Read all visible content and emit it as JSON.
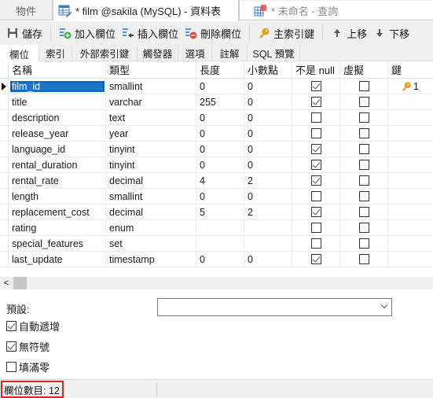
{
  "doc_tabs": {
    "objects": "物件",
    "active": "* film @sakila (MySQL) - 資料表",
    "query": "* 未命名 - 查詢"
  },
  "toolbar": {
    "save": "儲存",
    "add_field": "加入欄位",
    "insert_field": "插入欄位",
    "delete_field": "刪除欄位",
    "primary_key": "主索引鍵",
    "move_up": "上移",
    "move_down": "下移"
  },
  "sub_tabs": [
    "欄位",
    "索引",
    "外部索引鍵",
    "觸發器",
    "選項",
    "註解",
    "SQL 預覽"
  ],
  "grid": {
    "columns": [
      "名稱",
      "類型",
      "長度",
      "小數點",
      "不是 null",
      "虛擬",
      "鍵"
    ],
    "rows": [
      {
        "name": "film_id",
        "type": "smallint",
        "length": "0",
        "decimals": "0",
        "not_null": true,
        "virtual": false,
        "key": "1",
        "selected": true
      },
      {
        "name": "title",
        "type": "varchar",
        "length": "255",
        "decimals": "0",
        "not_null": true,
        "virtual": false,
        "key": ""
      },
      {
        "name": "description",
        "type": "text",
        "length": "0",
        "decimals": "0",
        "not_null": false,
        "virtual": false,
        "key": ""
      },
      {
        "name": "release_year",
        "type": "year",
        "length": "0",
        "decimals": "0",
        "not_null": false,
        "virtual": false,
        "key": ""
      },
      {
        "name": "language_id",
        "type": "tinyint",
        "length": "0",
        "decimals": "0",
        "not_null": true,
        "virtual": false,
        "key": ""
      },
      {
        "name": "rental_duration",
        "type": "tinyint",
        "length": "0",
        "decimals": "0",
        "not_null": true,
        "virtual": false,
        "key": ""
      },
      {
        "name": "rental_rate",
        "type": "decimal",
        "length": "4",
        "decimals": "2",
        "not_null": true,
        "virtual": false,
        "key": ""
      },
      {
        "name": "length",
        "type": "smallint",
        "length": "0",
        "decimals": "0",
        "not_null": false,
        "virtual": false,
        "key": ""
      },
      {
        "name": "replacement_cost",
        "type": "decimal",
        "length": "5",
        "decimals": "2",
        "not_null": true,
        "virtual": false,
        "key": ""
      },
      {
        "name": "rating",
        "type": "enum",
        "length": "",
        "decimals": "",
        "not_null": false,
        "virtual": false,
        "key": ""
      },
      {
        "name": "special_features",
        "type": "set",
        "length": "",
        "decimals": "",
        "not_null": false,
        "virtual": false,
        "key": ""
      },
      {
        "name": "last_update",
        "type": "timestamp",
        "length": "0",
        "decimals": "0",
        "not_null": true,
        "virtual": false,
        "key": ""
      }
    ]
  },
  "properties": {
    "default_label": "預設:",
    "default_value": "",
    "checkboxes": [
      {
        "label": "自動遞增",
        "checked": true
      },
      {
        "label": "無符號",
        "checked": true
      },
      {
        "label": "填滿零",
        "checked": false
      }
    ]
  },
  "status": {
    "field_count": "欄位數目: 12"
  },
  "colors": {
    "selection": "#1e74c8",
    "highlight_border": "#d9262b",
    "key_icon": "#e3a21a"
  }
}
